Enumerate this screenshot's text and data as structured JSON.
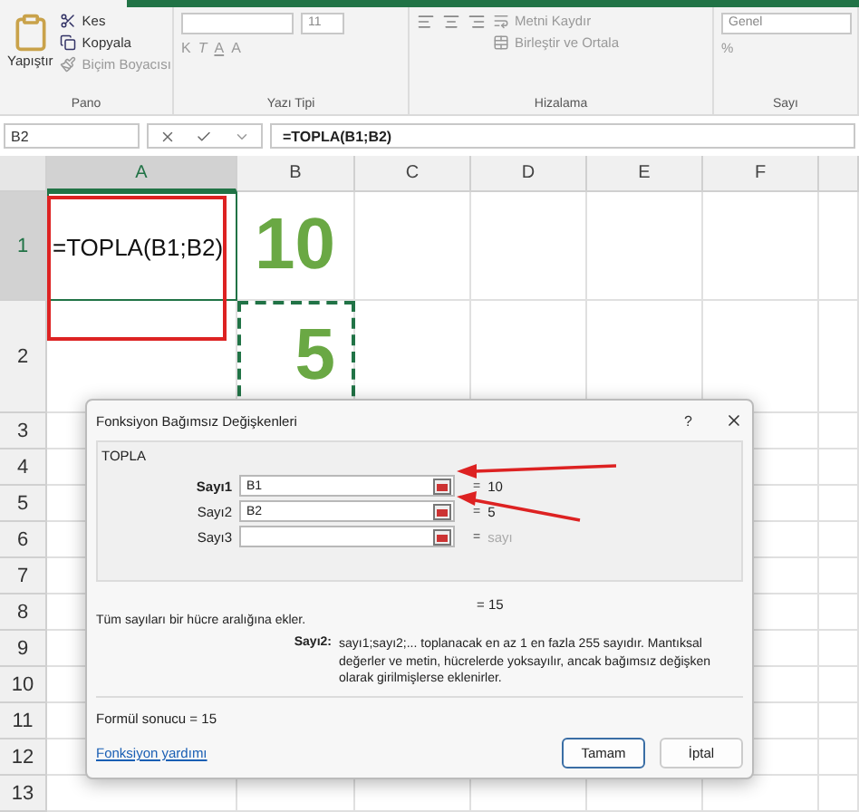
{
  "ribbon": {
    "clipboard": {
      "paste": "Yapıştır",
      "cut": "Kes",
      "copy": "Kopyala",
      "format_painter": "Biçim Boyacısı",
      "label": "Pano"
    },
    "font": {
      "size": "11",
      "bold": "K",
      "italic": "T",
      "underline": "A",
      "font_color": "A",
      "label": "Yazı Tipi"
    },
    "alignment": {
      "wrap": "Metni Kaydır",
      "merge": "Birleştir ve Ortala",
      "label": "Hizalama"
    },
    "number": {
      "format": "Genel",
      "percent": "%",
      "label": "Sayı"
    }
  },
  "formula_bar": {
    "name_box": "B2",
    "formula": "=TOPLA(B1;B2)"
  },
  "sheet": {
    "columns": [
      {
        "label": "A",
        "selected": true
      },
      {
        "label": "B",
        "selected": false
      },
      {
        "label": "C",
        "selected": false
      },
      {
        "label": "D",
        "selected": false
      },
      {
        "label": "E",
        "selected": false
      },
      {
        "label": "F",
        "selected": false
      },
      {
        "selected": false
      }
    ],
    "rows": [
      {
        "header": "1",
        "selected": true,
        "cells": [
          {
            "kind": "formula",
            "text": "=TOPLA(B1;B2)"
          },
          {
            "kind": "big",
            "text": "10"
          }
        ]
      },
      {
        "header": "2",
        "selected": false,
        "cells": [
          {
            "kind": "blank"
          },
          {
            "kind": "big",
            "text": "5",
            "marquee": true
          }
        ]
      },
      {
        "header": "3",
        "selected": false
      },
      {
        "header": "4",
        "selected": false
      },
      {
        "header": "5",
        "selected": false
      },
      {
        "header": "6",
        "selected": false
      },
      {
        "header": "7",
        "selected": false
      },
      {
        "header": "8",
        "selected": false
      },
      {
        "header": "9",
        "selected": false
      },
      {
        "header": "10",
        "selected": false
      },
      {
        "header": "11",
        "selected": false
      },
      {
        "header": "12",
        "selected": false
      },
      {
        "header": "13",
        "selected": false
      }
    ]
  },
  "dialog": {
    "title": "Fonksiyon Bağımsız Değişkenleri",
    "help": "?",
    "function_name": "TOPLA",
    "arguments": [
      {
        "label": "Sayı1",
        "required": true,
        "value": "B1",
        "equals": "=",
        "reading": "10",
        "dimmed": false
      },
      {
        "label": "Sayı2",
        "required": false,
        "value": "B2",
        "equals": "=",
        "reading": "5",
        "dimmed": false
      },
      {
        "label": "Sayı3",
        "required": false,
        "equals": "=",
        "reading": "sayı",
        "dimmed": true
      }
    ],
    "result_line": "=  15",
    "description": "Tüm sayıları bir hücre aralığına ekler.",
    "argument_name": "Sayı2:",
    "argument_help": "sayı1;sayı2;... toplanacak en az 1 en fazla 255 sayıdır. Mantıksal değerler ve metin, hücrelerde yoksayılır, ancak bağımsız değişken olarak girilmişlerse eklenirler.",
    "formula_result": "Formül sonucu =  15",
    "help_link": "Fonksiyon yardımı",
    "buttons": [
      {
        "label": "Tamam",
        "selected": true
      },
      {
        "label": "İptal",
        "selected": false
      }
    ]
  }
}
